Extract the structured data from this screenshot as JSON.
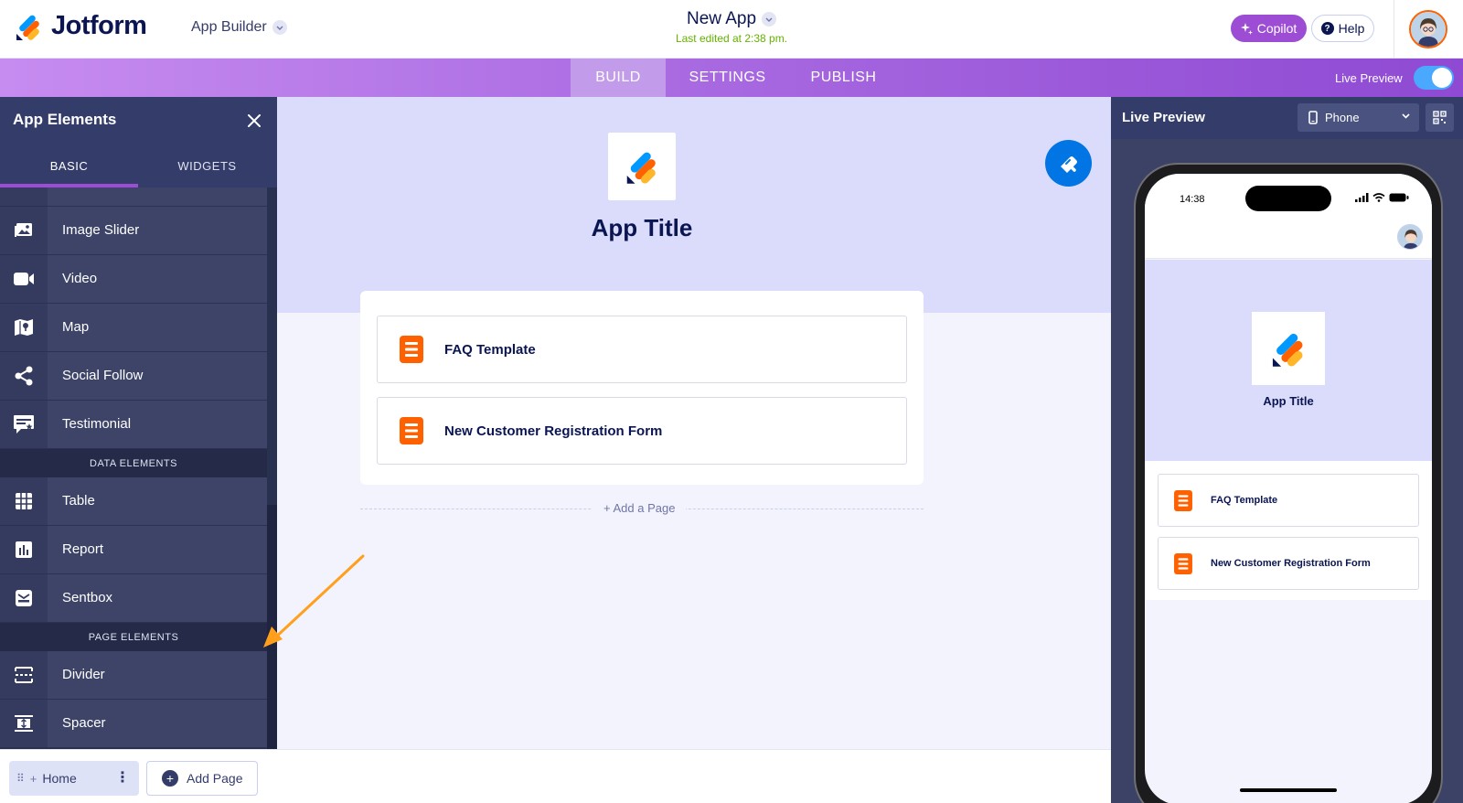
{
  "header": {
    "brand": "Jotform",
    "product_menu": "App Builder",
    "doc_title": "New App",
    "last_edited": "Last edited at 2:38 pm.",
    "copilot_label": "Copilot",
    "help_label": "Help"
  },
  "nav": {
    "tabs": [
      {
        "label": "BUILD",
        "active": true
      },
      {
        "label": "SETTINGS",
        "active": false
      },
      {
        "label": "PUBLISH",
        "active": false
      }
    ],
    "live_preview_label": "Live Preview",
    "live_preview_on": true
  },
  "sidebar": {
    "title": "App Elements",
    "tabs": [
      {
        "label": "BASIC",
        "active": true
      },
      {
        "label": "WIDGETS",
        "active": false
      }
    ],
    "basic_items": [
      {
        "label": "Image Slider",
        "icon": "image-slider-icon"
      },
      {
        "label": "Video",
        "icon": "video-camera-icon"
      },
      {
        "label": "Map",
        "icon": "map-icon"
      },
      {
        "label": "Social Follow",
        "icon": "share-icon"
      },
      {
        "label": "Testimonial",
        "icon": "testimonial-icon"
      }
    ],
    "data_section_label": "DATA ELEMENTS",
    "data_items": [
      {
        "label": "Table",
        "icon": "table-grid-icon"
      },
      {
        "label": "Report",
        "icon": "report-chart-icon"
      },
      {
        "label": "Sentbox",
        "icon": "sentbox-icon"
      }
    ],
    "page_section_label": "PAGE ELEMENTS",
    "page_items": [
      {
        "label": "Divider",
        "icon": "divider-icon"
      },
      {
        "label": "Spacer",
        "icon": "spacer-icon"
      }
    ]
  },
  "canvas": {
    "app_title": "App Title",
    "pages": [
      {
        "label": "FAQ Template"
      },
      {
        "label": "New Customer Registration Form"
      }
    ],
    "add_page_link": "+ Add a Page"
  },
  "bottombar": {
    "home_label": "Home",
    "add_page_label": "Add Page"
  },
  "preview": {
    "title": "Live Preview",
    "device": "Phone",
    "status_time": "14:38",
    "app_title": "App Title",
    "pages": [
      {
        "label": "FAQ Template"
      },
      {
        "label": "New Customer Registration Form"
      }
    ]
  },
  "colors": {
    "brand_navy": "#0a1551",
    "accent_purple": "#9c4dd3",
    "form_orange": "#ff6100",
    "sidebar_bg": "#293151",
    "canvas_banner": "#dbdcfc",
    "edited_green": "#64b200",
    "toggle_blue": "#4aa8ff"
  }
}
